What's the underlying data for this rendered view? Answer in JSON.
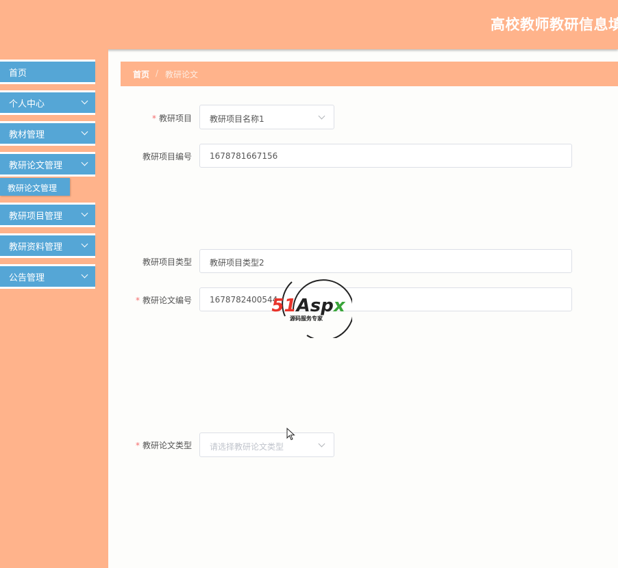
{
  "header": {
    "title": "高校教师教研信息填"
  },
  "sidebar": {
    "items": [
      {
        "label": "首页"
      },
      {
        "label": "个人中心"
      },
      {
        "label": "教材管理"
      },
      {
        "label": "教研论文管理"
      },
      {
        "label": "教研项目管理"
      },
      {
        "label": "教研资料管理"
      },
      {
        "label": "公告管理"
      }
    ],
    "submenu": {
      "label": "教研论文管理"
    }
  },
  "breadcrumb": {
    "home": "首页",
    "separator": "/",
    "current": "教研论文"
  },
  "form": {
    "required_mark": "*",
    "project": {
      "label": "教研项目",
      "value": "教研项目名称1"
    },
    "project_no": {
      "label": "教研项目编号",
      "value": "1678781667156"
    },
    "project_type": {
      "label": "教研项目类型",
      "value": "教研项目类型2"
    },
    "paper_no": {
      "label": "教研论文编号",
      "value": "1678782400544"
    },
    "paper_type": {
      "label": "教研论文类型",
      "placeholder": "请选择教研论文类型"
    }
  },
  "watermark": {
    "brand": "51Aspx",
    "slogan": "源码服务专家"
  },
  "colors": {
    "accent": "#ffb38b",
    "menu": "#55a6d6",
    "required": "#f56c6c",
    "watermark_red": "#e8342b",
    "watermark_green": "#3aa53a"
  }
}
